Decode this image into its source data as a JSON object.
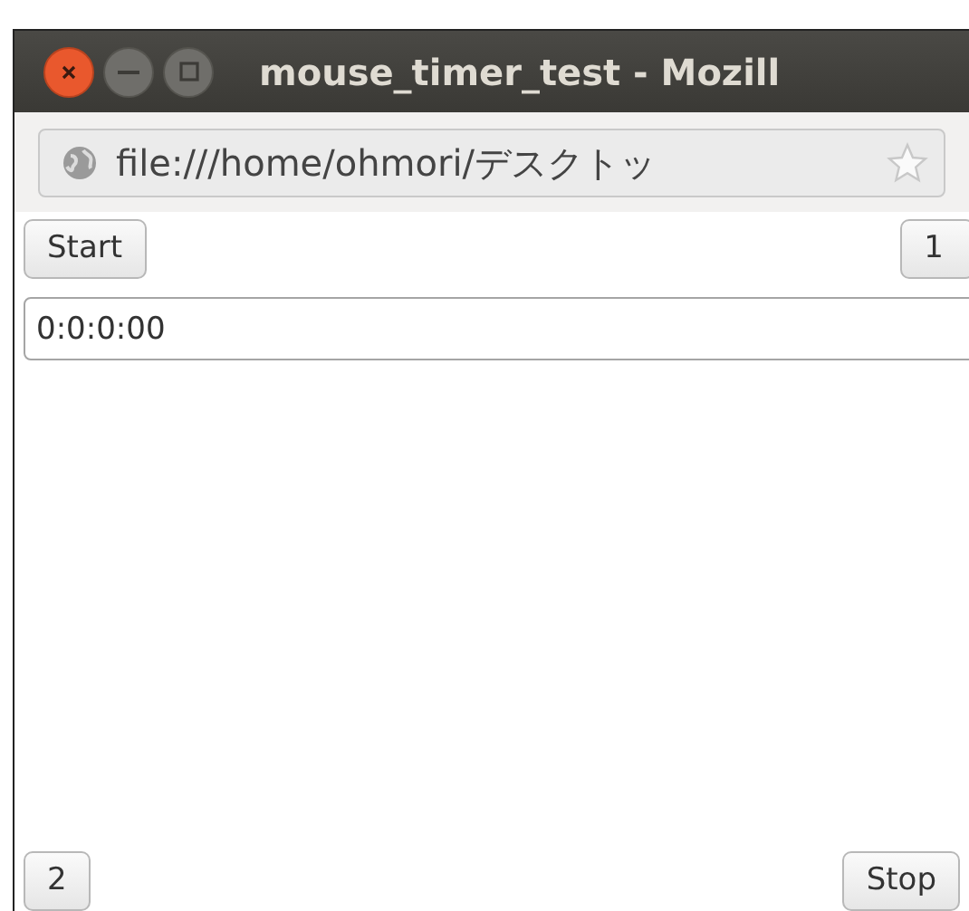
{
  "window": {
    "title": "mouse_timer_test - Mozill"
  },
  "address_bar": {
    "value": "file:///home/ohmori/デスクトッ"
  },
  "top_buttons": [
    "Start",
    "1"
  ],
  "time_field": {
    "value": "0:0:0:00"
  },
  "bottom_buttons": [
    "2",
    "Stop"
  ]
}
